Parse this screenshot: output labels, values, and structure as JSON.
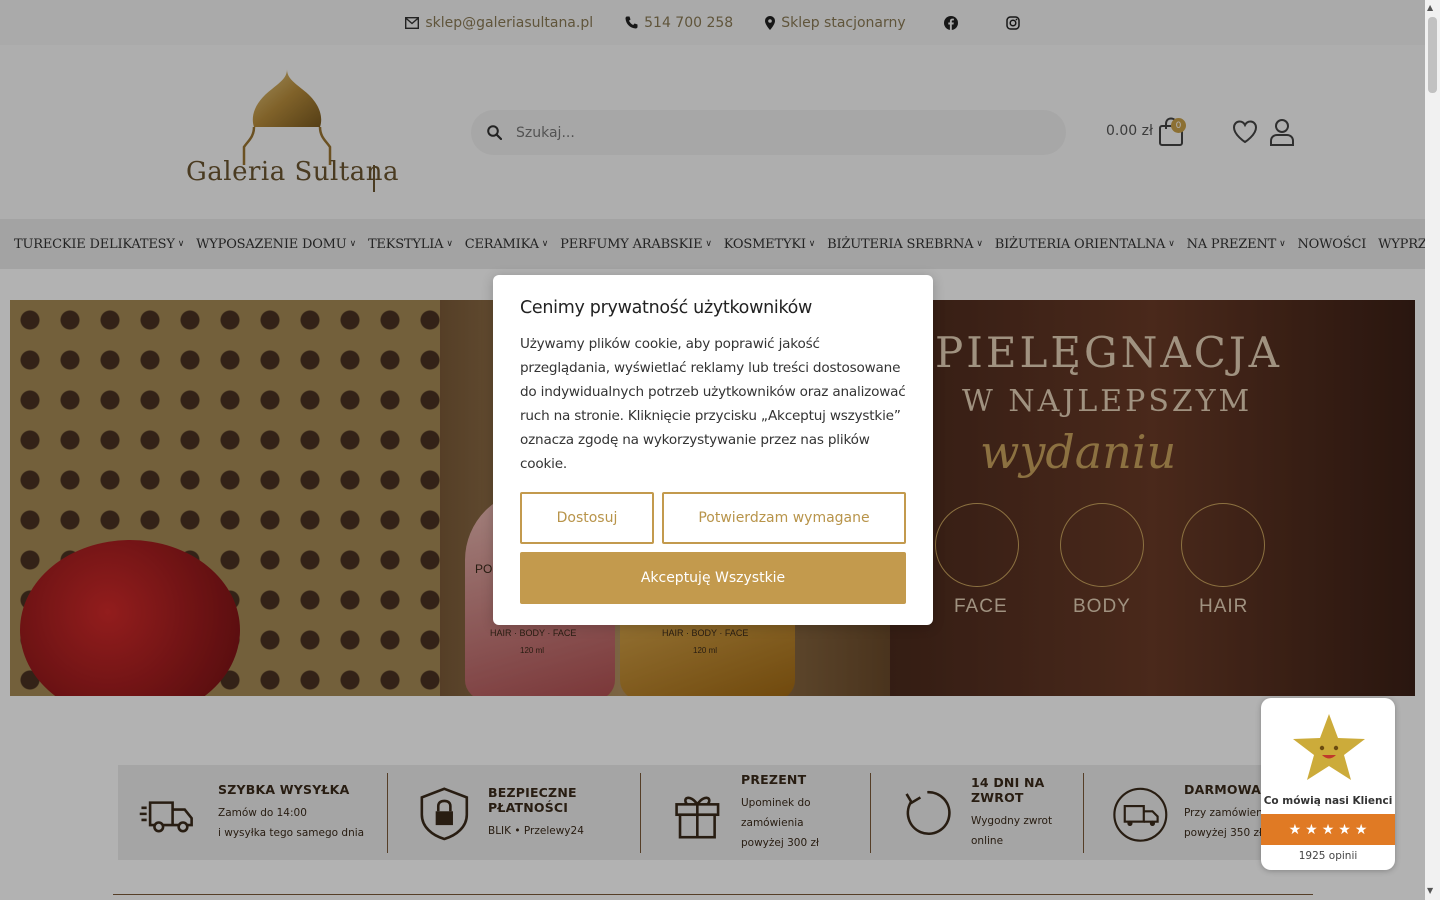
{
  "topbar": {
    "email": "sklep@galeriasultana.pl",
    "phone": "514 700 258",
    "store": "Sklep stacjonarny",
    "icons": [
      "envelope-icon",
      "phone-icon",
      "map-pin-icon",
      "facebook-icon",
      "instagram-icon"
    ]
  },
  "header": {
    "logo_text": "Galeria Sultana",
    "search_placeholder": "Szukaj...",
    "cart_total": "0.00 zł",
    "cart_count": "0"
  },
  "nav": {
    "items": [
      {
        "label": "TURECKIE DELIKATESY",
        "has_dropdown": true
      },
      {
        "label": "WYPOSAZENIE DOMU",
        "has_dropdown": true
      },
      {
        "label": "TEKSTYLIA",
        "has_dropdown": true
      },
      {
        "label": "CERAMIKA",
        "has_dropdown": true
      },
      {
        "label": "PERFUMY ARABSKIE",
        "has_dropdown": true
      },
      {
        "label": "KOSMETYKI",
        "has_dropdown": true
      },
      {
        "label": "BIŻUTERIA SREBRNA",
        "has_dropdown": true
      },
      {
        "label": "BIŻUTERIA ORIENTALNA",
        "has_dropdown": true
      },
      {
        "label": "NA PREZENT",
        "has_dropdown": true
      },
      {
        "label": "NOWOŚCI",
        "has_dropdown": false
      },
      {
        "label": "WYPRZEDAŻ",
        "has_dropdown": false
      }
    ]
  },
  "hero": {
    "line1": "PIELĘGNACJA",
    "line2": "W NAJLEPSZYM",
    "line3": "wydaniu",
    "categories": [
      "FACE",
      "BODY",
      "HAIR"
    ],
    "bottle_label_left": "PO",
    "bottle_sub": "HAIR · BODY · FACE",
    "bottle_volume": "120 ml"
  },
  "cookie": {
    "title": "Cenimy prywatność użytkowników",
    "body": "Używamy plików cookie, aby poprawić jakość przeglądania, wyświetlać reklamy lub treści dostosowane do indywidualnych potrzeb użytkowników oraz analizować ruch na stronie. Kliknięcie przycisku „Akceptuj wszystkie” oznacza zgodę na wykorzystywanie przez nas plików cookie.",
    "btn_customize": "Dostosuj",
    "btn_required": "Potwierdzam wymagane",
    "btn_accept": "Akceptuję Wszystkie"
  },
  "features": [
    {
      "title": "SZYBKA WYSYŁKA",
      "sub1": "Zamów do 14:00",
      "sub2": "i wysyłka tego samego dnia",
      "icon": "truck-icon"
    },
    {
      "title": "BEZPIECZNE PŁATNOŚCI",
      "sub1": "BLIK  •  Przelewy24",
      "sub2": "",
      "icon": "shield-lock-icon"
    },
    {
      "title": "PREZENT",
      "sub1": "Upominek do zamówienia",
      "sub2": "powyżej 300 zł",
      "icon": "gift-icon"
    },
    {
      "title": "14 DNI NA ZWROT",
      "sub1": "Wygodny zwrot online",
      "sub2": "",
      "icon": "return-arrow-icon"
    },
    {
      "title": "DARMOWA DOS",
      "sub1": "Przy zamówieniac",
      "sub2": "powyżej 350 zł",
      "icon": "delivery-van-icon"
    }
  ],
  "reviews": {
    "title": "Co mówią nasi Klienci",
    "rating": 5,
    "count": "1925 opinii"
  },
  "colors": {
    "accent": "#c39a4d",
    "brown": "#7a5a38",
    "review_orange": "#e07a24"
  }
}
